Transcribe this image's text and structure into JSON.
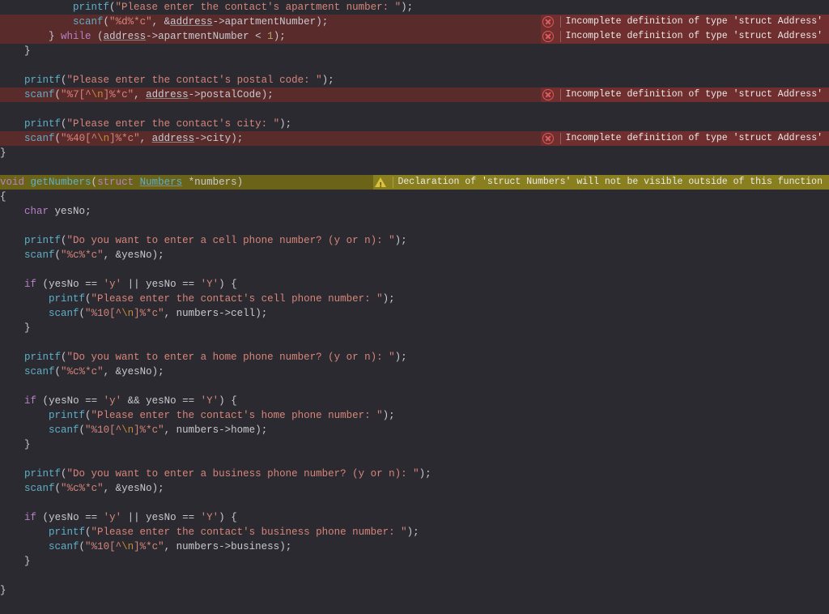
{
  "errors": {
    "incomplete_address": "Incomplete definition of type 'struct Address'"
  },
  "warnings": {
    "numbers_visibility": "Declaration of 'struct Numbers' will not be visible outside of this function"
  },
  "tokens": {
    "void": "void",
    "struct": "struct",
    "char": "char",
    "if": "if",
    "while": "while",
    "printf": "printf",
    "scanf": "scanf",
    "getNumbers": "getNumbers",
    "Numbers": "Numbers",
    "numbers_param": "*numbers",
    "yesNo": "yesNo",
    "address": "address",
    "apartmentNumber": "apartmentNumber",
    "postalCode": "postalCode",
    "city": "city",
    "cell": "cell",
    "home": "home",
    "business": "business",
    "one": "1"
  },
  "strings": {
    "apt_prompt": "\"Please enter the contact's apartment number: \"",
    "postal_prompt": "\"Please enter the contact's postal code: \"",
    "city_prompt": "\"Please enter the contact's city: \"",
    "cell_q": "\"Do you want to enter a cell phone number? (y or n): \"",
    "cell_prompt": "\"Please enter the contact's cell phone number: \"",
    "home_q": "\"Do you want to enter a home phone number? (y or n): \"",
    "home_prompt": "\"Please enter the contact's home phone number: \"",
    "biz_q": "\"Do you want to enter a business phone number? (y or n): \"",
    "biz_prompt": "\"Please enter the contact's business phone number: \""
  },
  "fmt": {
    "d_star_c": {
      "open": "\"",
      "p1": "%d%*c",
      "close": "\""
    },
    "c_star_c": {
      "open": "\"",
      "p1": "%c%*c",
      "close": "\""
    },
    "seven": {
      "open": "\"",
      "p1": "%7[^",
      "esc": "\\n",
      "p2": "]%*c",
      "close": "\""
    },
    "forty": {
      "open": "\"",
      "p1": "%40[^",
      "esc": "\\n",
      "p2": "]%*c",
      "close": "\""
    },
    "ten": {
      "open": "\"",
      "p1": "%10[^",
      "esc": "\\n",
      "p2": "]%*c",
      "close": "\""
    }
  },
  "chars": {
    "y": "'y'",
    "Y": "'Y'"
  },
  "punct": {
    "lparen": "(",
    "rparen": ")",
    "lbrace": "{",
    "rbrace": "}",
    "lbrace_sp": " {",
    "semi": ";",
    "comma_sp": ", ",
    "amp": "&",
    "arrow": "->",
    "lt": " < ",
    "eq": " == ",
    "or": " || ",
    "and": " && "
  }
}
